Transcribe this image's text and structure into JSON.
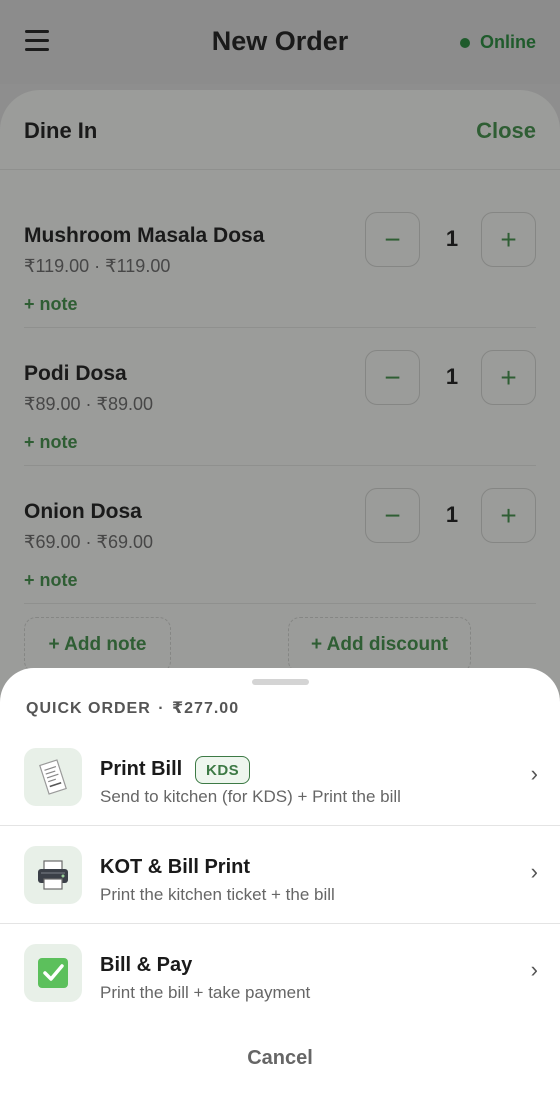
{
  "header": {
    "title": "New Order",
    "status": "Online"
  },
  "order": {
    "mode": "Dine In",
    "close_label": "Close",
    "items": [
      {
        "name": "Mushroom Masala Dosa",
        "price": "₹119.00 · ₹119.00",
        "qty": "1",
        "note": "+ note"
      },
      {
        "name": "Podi Dosa",
        "price": "₹89.00 · ₹89.00",
        "qty": "1",
        "note": "+ note"
      },
      {
        "name": "Onion Dosa",
        "price": "₹69.00 · ₹69.00",
        "qty": "1",
        "note": "+ note"
      }
    ],
    "add_note": "+ Add note",
    "add_discount": "+ Add discount"
  },
  "sheet": {
    "title_prefix": "QUICK ORDER",
    "title_sep": "·",
    "total": "₹277.00",
    "actions": [
      {
        "title": "Print Bill",
        "badge": "KDS",
        "subtitle": "Send to kitchen (for KDS) + Print the bill",
        "icon": "receipt-icon"
      },
      {
        "title": "KOT & Bill Print",
        "subtitle": "Print the kitchen ticket + the bill",
        "icon": "printer-icon"
      },
      {
        "title": "Bill & Pay",
        "subtitle": "Print the bill + take payment",
        "icon": "check-icon"
      }
    ],
    "cancel_label": "Cancel"
  },
  "colors": {
    "accent": "#2f5e34",
    "badge": "#3d7a45",
    "overlay": "#9b9c9a"
  }
}
